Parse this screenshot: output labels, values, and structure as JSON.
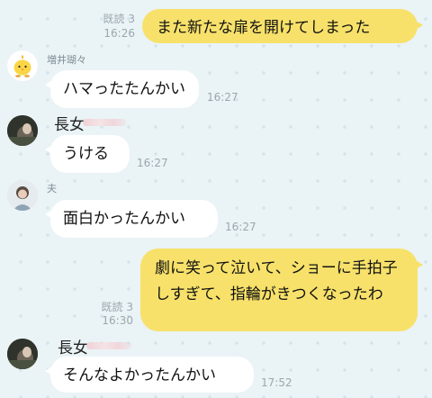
{
  "messages": [
    {
      "text": "また新たな扉を開けてしまった",
      "read": "既読 3",
      "time": "16:26"
    },
    {
      "sender": "増井瑚々",
      "text": "ハマったたんかい",
      "time": "16:27"
    },
    {
      "sender": "長女",
      "text": "うける",
      "time": "16:27"
    },
    {
      "sender": "夫",
      "text": "面白かったんかい",
      "time": "16:27"
    },
    {
      "text": "劇に笑って泣いて、ショーに手拍子しすぎて、指輪がきつくなったわ",
      "read": "既読 3",
      "time": "16:30"
    },
    {
      "sender": "長女",
      "text": "そんなよかったんかい",
      "time": "17:52"
    }
  ],
  "colors": {
    "background": "#eaf3f6",
    "outgoing_bubble": "#f7e16a",
    "incoming_bubble": "#ffffff",
    "meta_text": "#9aa8ad"
  }
}
